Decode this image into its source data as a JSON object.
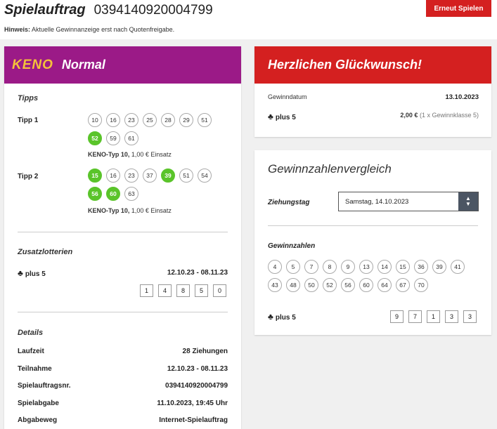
{
  "header": {
    "title": "Spielauftrag",
    "order_number": "0394140920004799",
    "hint_label": "Hinweis:",
    "hint_text": "Aktuelle Gewinnanzeige erst nach Quotenfreigabe.",
    "replay_label": "Erneut Spielen"
  },
  "keno": {
    "logo": "KENO",
    "type": "Normal",
    "tipps_heading": "Tipps",
    "tipps": [
      {
        "label": "Tipp 1",
        "numbers": [
          "10",
          "16",
          "23",
          "25",
          "28",
          "29",
          "51",
          "52",
          "59",
          "61"
        ],
        "hits": [
          false,
          false,
          false,
          false,
          false,
          false,
          false,
          true,
          false,
          false
        ],
        "meta_type": "KENO-Typ 10,",
        "meta_stake": "1,00 € Einsatz"
      },
      {
        "label": "Tipp 2",
        "numbers": [
          "15",
          "16",
          "23",
          "37",
          "39",
          "51",
          "54",
          "56",
          "60",
          "63"
        ],
        "hits": [
          true,
          false,
          false,
          false,
          true,
          false,
          false,
          true,
          true,
          false
        ],
        "meta_type": "KENO-Typ 10,",
        "meta_stake": "1,00 € Einsatz"
      }
    ],
    "zusatz_heading": "Zusatzlotterien",
    "plus5_label": "plus 5",
    "plus5_period": "12.10.23 - 08.11.23",
    "plus5_digits": [
      "1",
      "4",
      "8",
      "5",
      "0"
    ],
    "details_heading": "Details",
    "details": [
      {
        "label": "Laufzeit",
        "value": "28 Ziehungen"
      },
      {
        "label": "Teilnahme",
        "value": "12.10.23 - 08.11.23"
      },
      {
        "label": "Spielauftragsnr.",
        "value": "0394140920004799"
      },
      {
        "label": "Spielabgabe",
        "value": "11.10.2023, 19:45 Uhr"
      },
      {
        "label": "Abgabeweg",
        "value": "Internet-Spielauftrag"
      }
    ]
  },
  "win": {
    "heading": "Herzlichen Glückwunsch!",
    "date_label": "Gewinndatum",
    "date_value": "13.10.2023",
    "plus5_label": "plus 5",
    "amount": "2,00 €",
    "class_info": "(1 x Gewinnklasse 5)"
  },
  "compare": {
    "heading": "Gewinnzahlenvergleich",
    "day_label": "Ziehungstag",
    "day_value": "Samstag, 14.10.2023",
    "numbers_label": "Gewinnzahlen",
    "numbers": [
      "4",
      "5",
      "7",
      "8",
      "9",
      "13",
      "14",
      "15",
      "36",
      "39",
      "41",
      "43",
      "48",
      "50",
      "52",
      "56",
      "60",
      "64",
      "67",
      "70"
    ],
    "plus5_label": "plus 5",
    "plus5_digits": [
      "9",
      "7",
      "1",
      "3",
      "3"
    ]
  },
  "colors": {
    "keno_purple": "#9b1a87",
    "accent_red": "#d42020",
    "hit_green": "#5ac42a"
  }
}
